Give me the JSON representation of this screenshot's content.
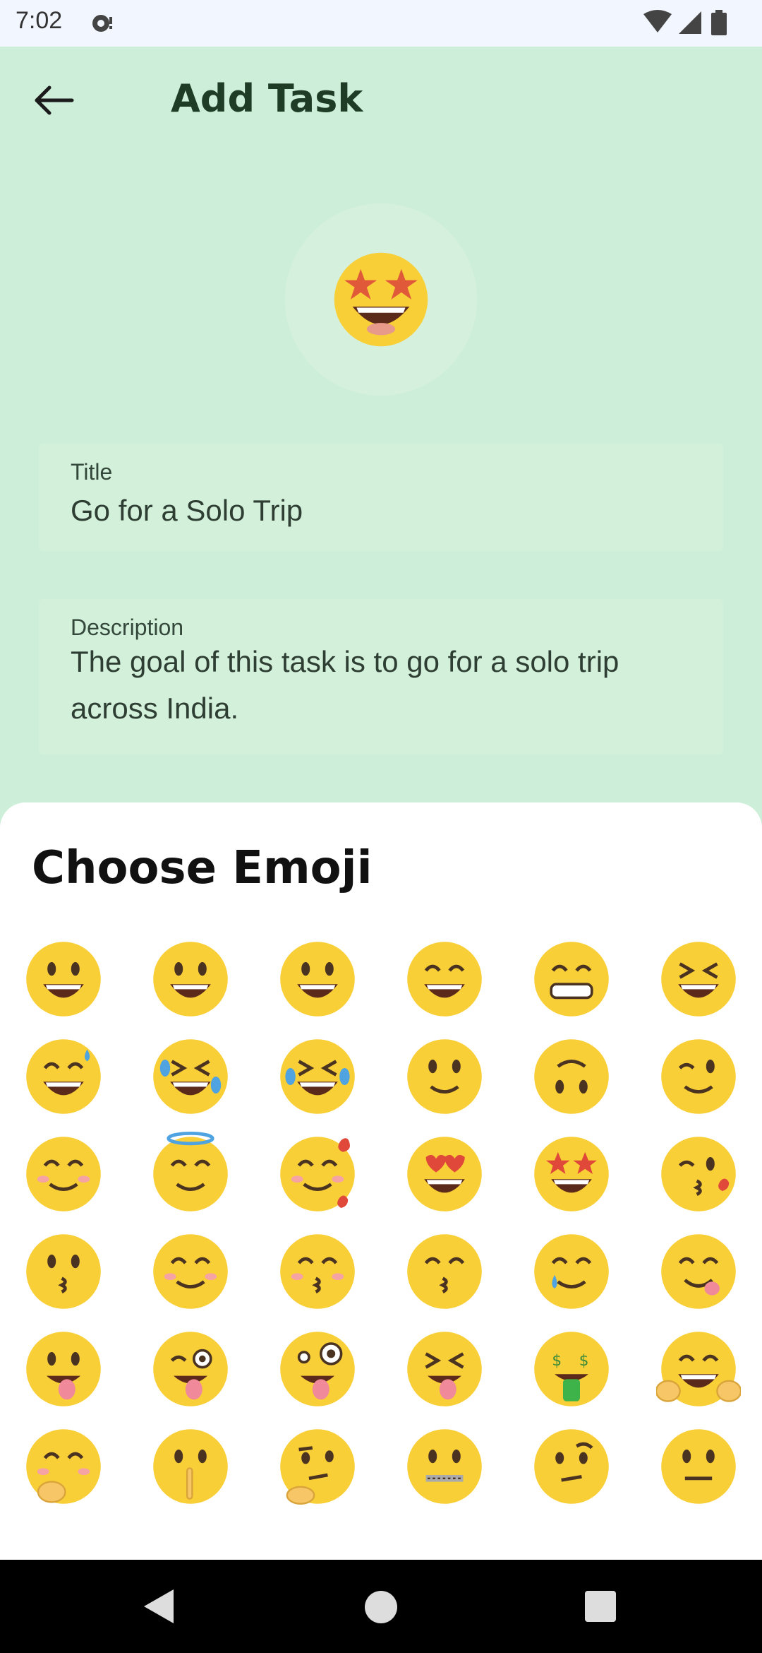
{
  "status_bar": {
    "time": "7:02",
    "notification_icon": "cloud-sync-icon",
    "wifi_icon": "wifi-icon",
    "signal_icon": "cellular-signal-icon",
    "battery_icon": "battery-icon"
  },
  "header": {
    "back_icon": "arrow-left-icon",
    "title": "Add Task"
  },
  "preview": {
    "emoji": "star-struck"
  },
  "form": {
    "title_label": "Title",
    "title_value": "Go for a Solo Trip",
    "description_label": "Description",
    "description_value": "The goal of this task is to go for a solo trip across India."
  },
  "sheet": {
    "title": "Choose Emoji",
    "emojis": [
      "grinning-face",
      "grinning-face-big-eyes",
      "smiley-face",
      "grinning-smiling-eyes",
      "beaming-face",
      "squinting-laughing-face",
      "grinning-sweat",
      "rolling-on-floor-laughing",
      "tears-of-joy",
      "slightly-smiling-face",
      "upside-down-face",
      "winking-face",
      "smiling-blushing-eyes",
      "smiling-halo",
      "smiling-hearts",
      "heart-eyes",
      "star-struck",
      "face-blowing-kiss",
      "kissing-face",
      "smiling-face",
      "kissing-closed-eyes",
      "kissing-smiling-eyes",
      "smiling-tear",
      "face-savoring-food",
      "face-with-tongue",
      "winking-tongue",
      "zany-face",
      "squinting-tongue",
      "money-mouth-face",
      "hugging-face",
      "hand-over-mouth",
      "shushing-face",
      "thinking-face",
      "zipper-mouth-face",
      "raised-eyebrow-face",
      "neutral-face"
    ]
  },
  "nav_bar": {
    "back": "triangle-back-icon",
    "home": "circle-home-icon",
    "recents": "square-recents-icon"
  },
  "colors": {
    "background": "#cdeed9",
    "field": "#d3f0db",
    "sheet": "#ffffff",
    "emoji_yellow": "#f9cf38",
    "title_green": "#1f3d26"
  }
}
